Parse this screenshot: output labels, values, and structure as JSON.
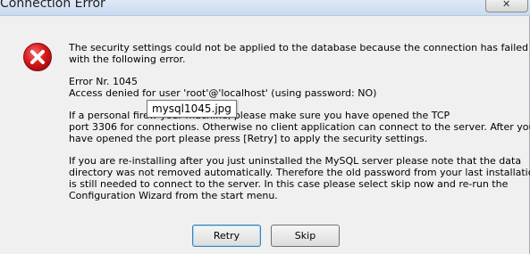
{
  "window": {
    "title": "Connection Error",
    "close_label": "✕"
  },
  "icons": {
    "error": "error-icon",
    "close": "close-icon"
  },
  "message": {
    "lines": [
      "The security settings could not be applied to the database because the connection has failed",
      "with the following error.",
      "Error Nr. 1045",
      "Access denied for user 'root'@'localhost' (using password: NO)",
      "If a personal firew                          your machine, please make sure you have opened the TCP",
      "port 3306 for connections. Otherwise no client application can connect to the server. After you",
      "have opened the port please press [Retry] to apply the security settings.",
      "If you are re-installing after you just uninstalled the MySQL server please note that the data",
      "directory was not removed automatically. Therefore the old password from your last installation",
      "is still needed to connect to the server. In this case please select skip now and re-run the",
      "Configuration Wizard from the start menu."
    ]
  },
  "tooltip": {
    "text": "mysql1045.jpg"
  },
  "buttons": {
    "retry_label": "Retry",
    "skip_label": "Skip"
  },
  "colors": {
    "error_red": "#d7191c",
    "window_bg": "#f0f0f0"
  }
}
